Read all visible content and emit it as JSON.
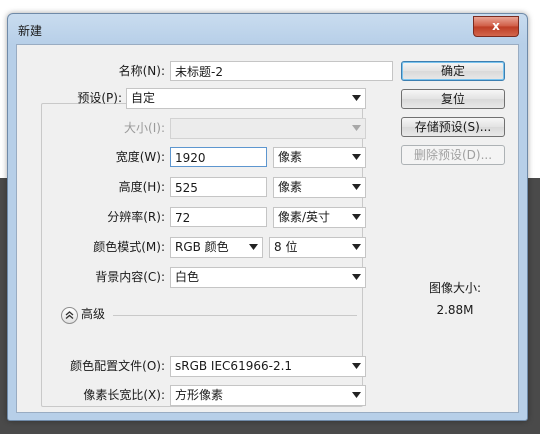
{
  "window": {
    "title": "新建",
    "close_glyph": "x"
  },
  "form": {
    "name_label": "名称(N):",
    "name_value": "未标题-2",
    "preset_label": "预设(P):",
    "preset_value": "自定",
    "size_label": "大小(I):",
    "size_value": "",
    "width_label": "宽度(W):",
    "width_value": "1920",
    "width_unit": "像素",
    "height_label": "高度(H):",
    "height_value": "525",
    "height_unit": "像素",
    "resolution_label": "分辨率(R):",
    "resolution_value": "72",
    "resolution_unit": "像素/英寸",
    "color_mode_label": "颜色模式(M):",
    "color_mode_value": "RGB 颜色",
    "bit_depth": "8 位",
    "background_label": "背景内容(C):",
    "background_value": "白色"
  },
  "advanced": {
    "label": "高级",
    "profile_label": "颜色配置文件(O):",
    "profile_value": "sRGB IEC61966-2.1",
    "aspect_label": "像素长宽比(X):",
    "aspect_value": "方形像素"
  },
  "buttons": {
    "ok": "确定",
    "reset": "复位",
    "save_preset": "存储预设(S)...",
    "delete_preset": "删除预设(D)..."
  },
  "image_size": {
    "label": "图像大小:",
    "value": "2.88M"
  },
  "colors": {
    "accent": "#5d96cf",
    "close": "#cf5a43",
    "title_bar": "#c9dcef"
  },
  "icons": {
    "dropdown": "chevron-down-icon",
    "advanced": "double-chevron-up-icon",
    "close": "close-icon"
  }
}
